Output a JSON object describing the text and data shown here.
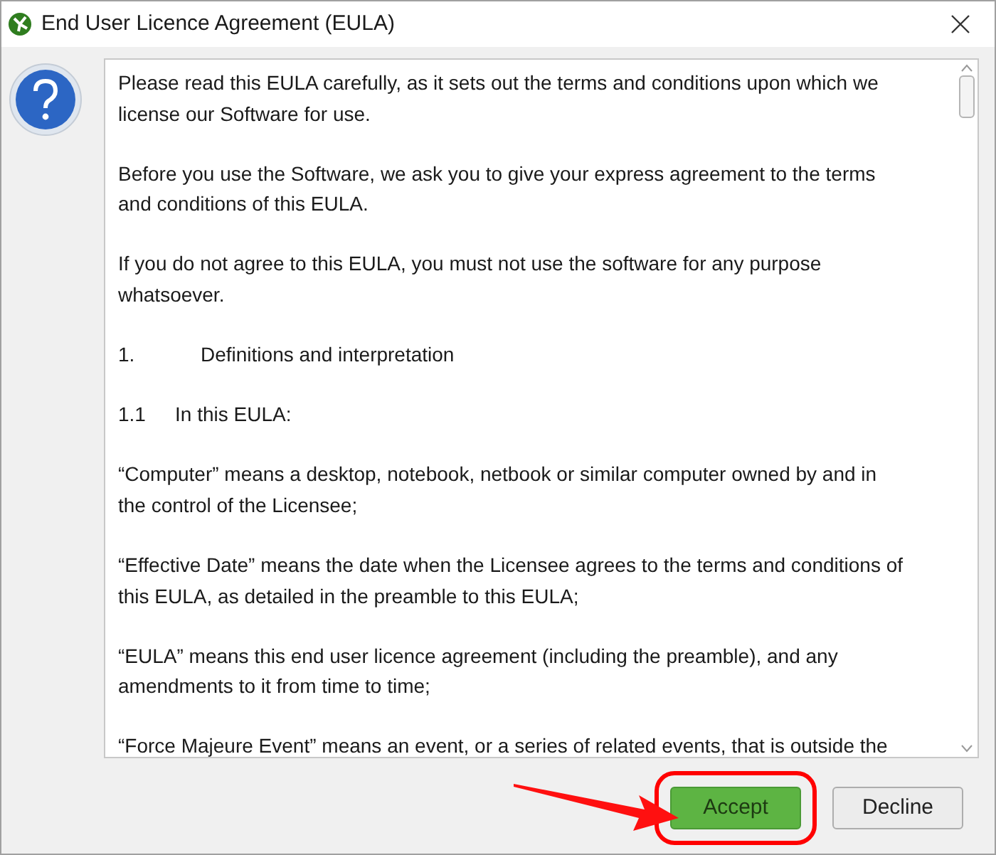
{
  "window": {
    "title": "End User Licence Agreement (EULA)"
  },
  "eula": {
    "paragraphs": [
      {
        "kind": "text",
        "lines": [
          "Please read this EULA carefully, as it sets out the terms and conditions upon which we",
          "license our Software for use."
        ]
      },
      {
        "kind": "text",
        "lines": [
          "Before you use the Software, we ask you to give your express agreement to the terms",
          "and conditions of this EULA."
        ]
      },
      {
        "kind": "text",
        "lines": [
          "If you do not agree to this EULA, you must not use the software for any purpose",
          "whatsoever."
        ]
      },
      {
        "kind": "heading",
        "number": "1.",
        "text": "Definitions and interpretation"
      },
      {
        "kind": "subheading",
        "number": "1.1",
        "text": "In this EULA:"
      },
      {
        "kind": "text",
        "lines": [
          "“Computer” means a desktop, notebook, netbook or similar computer owned by and in",
          "the control of the Licensee;"
        ]
      },
      {
        "kind": "text",
        "lines": [
          "“Effective Date” means the date when the Licensee agrees to the terms and conditions of",
          "this EULA, as detailed in the preamble to this EULA;"
        ]
      },
      {
        "kind": "text",
        "lines": [
          "“EULA” means this end user licence agreement (including the preamble), and any",
          "amendments to it from time to time;"
        ]
      },
      {
        "kind": "text",
        "lines": [
          "“Force Majeure Event” means an event, or a series of related events, that is outside the"
        ]
      }
    ]
  },
  "buttons": [
    {
      "label": "Accept",
      "highlighted": true
    },
    {
      "label": "Decline",
      "highlighted": false
    }
  ]
}
